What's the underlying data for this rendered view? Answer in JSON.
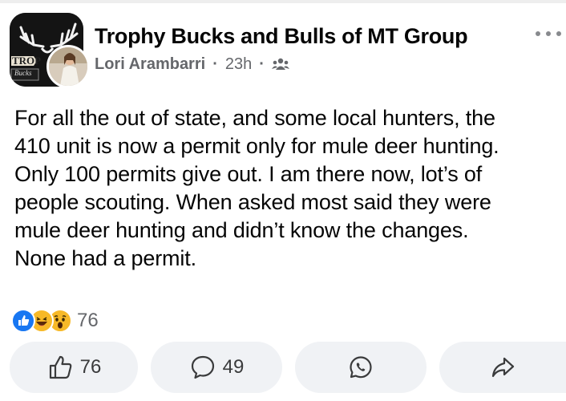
{
  "post": {
    "group_name": "Trophy Bucks and Bulls of MT Group",
    "author": "Lori Arambarri",
    "time": "23h",
    "audience_icon": "group-members-icon",
    "group_logo_text": "TROP",
    "group_logo_subtext": "Bucks",
    "body_lines": [
      "For all the out of state, and some local hunters, the",
      "410 unit is now a permit only for mule deer hunting.",
      "Only 100 permits give out. I am there now, lot’s of",
      "people scouting. When asked most said they were",
      "mule deer hunting and didn’t know the changes.",
      "None had a permit."
    ]
  },
  "reactions": {
    "icons": [
      "like-reaction-icon",
      "haha-reaction-icon",
      "wow-reaction-icon"
    ],
    "count": "76"
  },
  "actions": {
    "like_count": "76",
    "comment_count": "49"
  },
  "colors": {
    "like_blue": "#1877f2",
    "emoji_yellow": "#f7b928",
    "button_bg": "#f0f2f5",
    "meta_gray": "#65676b"
  }
}
